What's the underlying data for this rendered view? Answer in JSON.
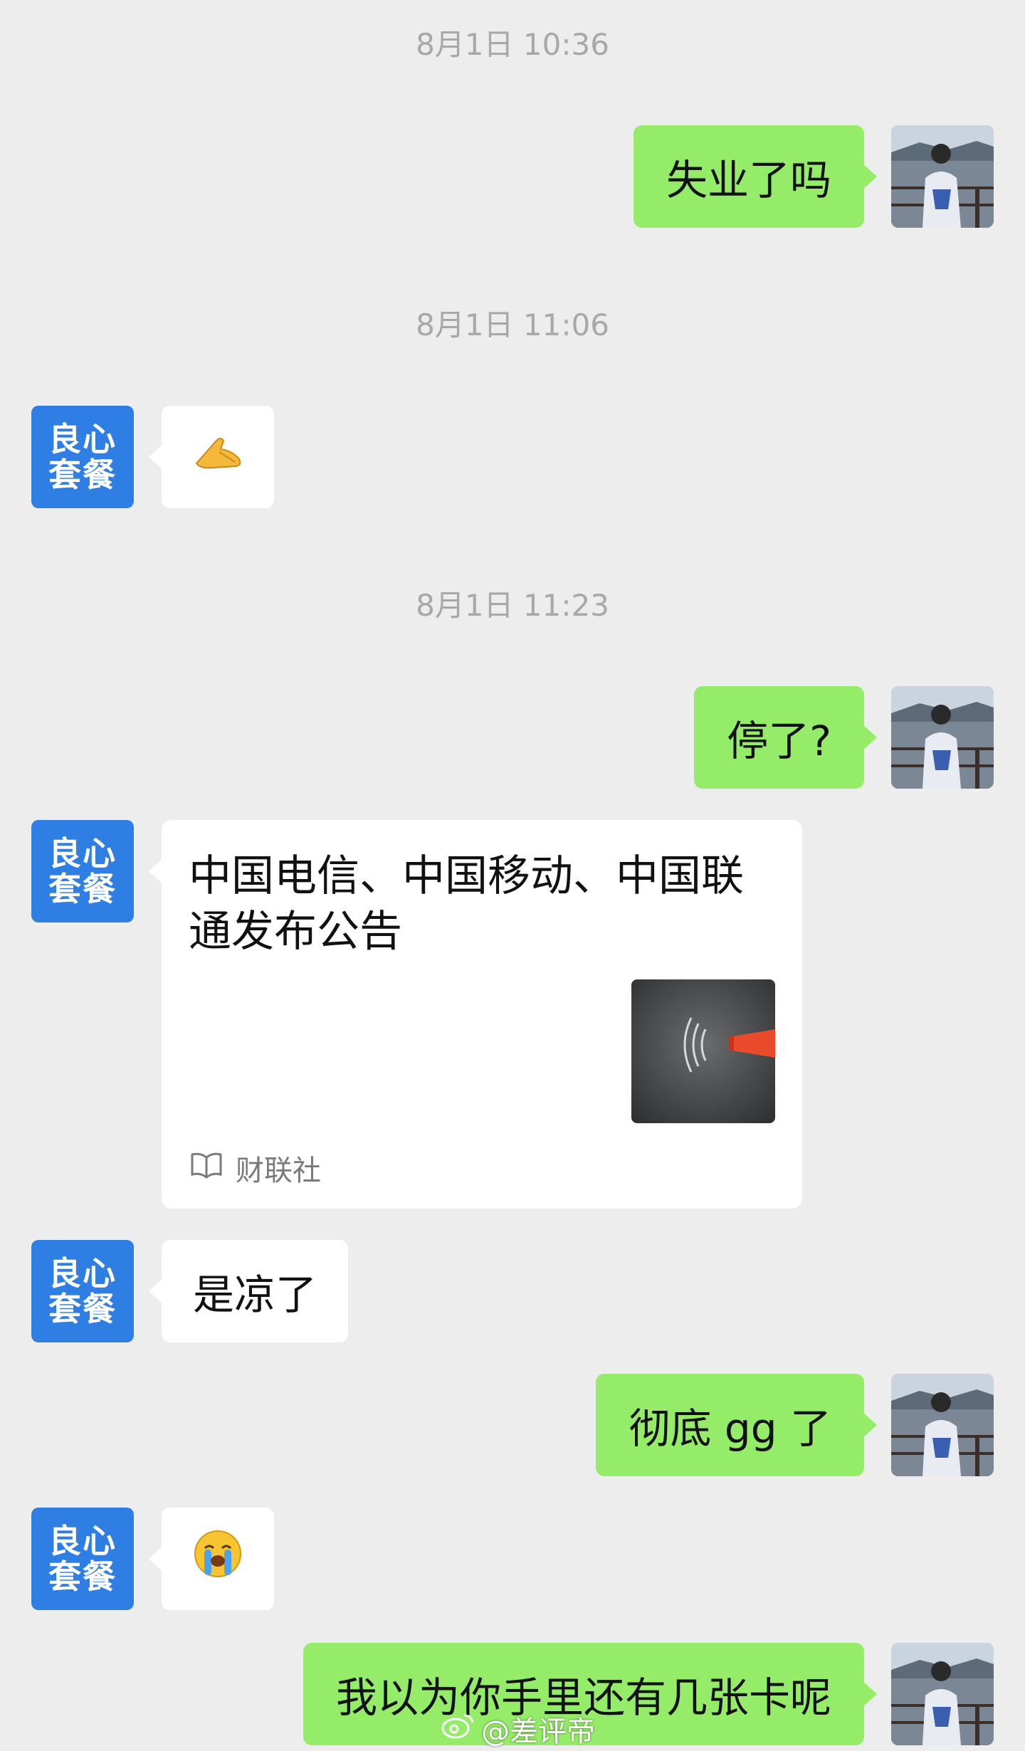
{
  "timestamps": [
    "8月1日 10:36",
    "8月1日 11:06",
    "8月1日 11:23"
  ],
  "brand_avatar": {
    "line1": "良心",
    "line2": "套餐",
    "color": "#2f7ee3"
  },
  "messages": {
    "m1": "失业了吗",
    "m2_emoji": "🫴",
    "m3": "停了?",
    "card": {
      "title": "中国电信、中国移动、中国联通发布公告",
      "source": "财联社",
      "source_icon": "book-icon"
    },
    "m5": "是凉了",
    "m6": "彻底 gg 了",
    "m7_emoji": "😭",
    "m8": "我以为你手里还有几张卡呢"
  },
  "watermark": {
    "text": "@差评帝",
    "icon": "weibo-icon"
  },
  "colors": {
    "background": "#ededed",
    "outgoing_bubble": "#95ec69",
    "incoming_bubble": "#ffffff",
    "timestamp": "#a8a8a8"
  }
}
